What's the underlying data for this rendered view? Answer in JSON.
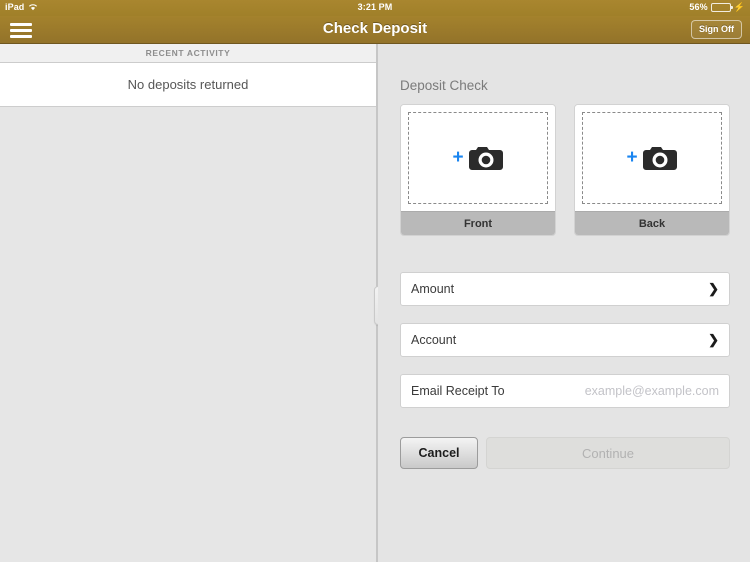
{
  "statusbar": {
    "device": "iPad",
    "wifi_icon": "wifi-icon",
    "time": "3:21 PM",
    "battery_percent": "56%",
    "battery_level": 56,
    "charging_icon": "lightning-bolt-icon"
  },
  "navbar": {
    "menu_icon": "hamburger-menu-icon",
    "title": "Check Deposit",
    "signoff_label": "Sign Off",
    "background_color": "#9a7a2b"
  },
  "master": {
    "section_header": "RECENT ACTIVITY",
    "empty_message": "No deposits returned"
  },
  "divider": {
    "grip_icon": "drag-handle-icon"
  },
  "detail": {
    "title": "Deposit Check",
    "cards": [
      {
        "label": "Front",
        "plus_icon": "plus-icon",
        "camera_icon": "camera-icon"
      },
      {
        "label": "Back",
        "plus_icon": "plus-icon",
        "camera_icon": "camera-icon"
      }
    ],
    "fields": [
      {
        "label": "Amount",
        "value": "",
        "placeholder": "",
        "accessory": "chevron-right-icon",
        "chevron": "❯"
      },
      {
        "label": "Account",
        "value": "",
        "placeholder": "",
        "accessory": "chevron-right-icon",
        "chevron": "❯"
      },
      {
        "label": "Email Receipt To",
        "value": "",
        "placeholder": "example@example.com",
        "accessory": "none",
        "chevron": ""
      }
    ],
    "buttons": {
      "cancel_label": "Cancel",
      "continue_label": "Continue",
      "continue_disabled": true
    }
  },
  "colors": {
    "brand_gold": "#9a7a2b",
    "accent_blue": "#1a85f0",
    "panel_grey": "#e4e4e4",
    "battery_green": "#4cd464"
  }
}
